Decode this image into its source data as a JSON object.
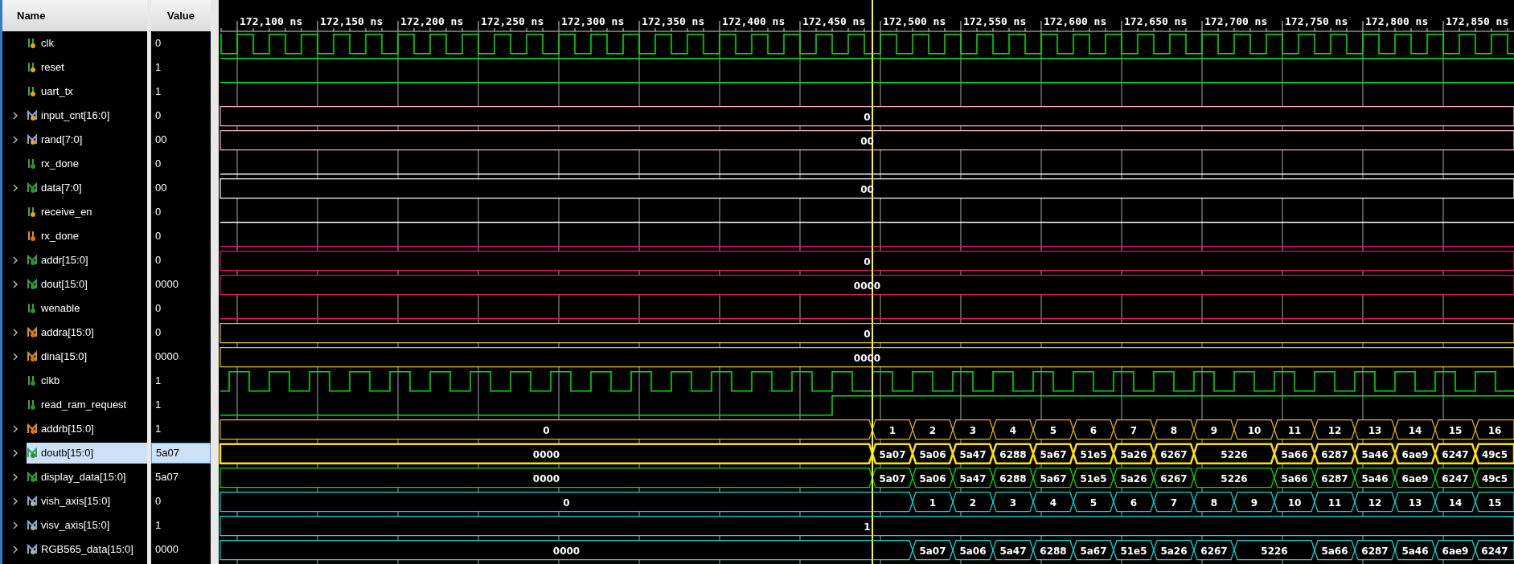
{
  "columns": {
    "name": "Name",
    "value": "Value"
  },
  "ruler": {
    "labels": [
      "172,100 ns",
      "172,150 ns",
      "172,200 ns",
      "172,250 ns",
      "172,300 ns",
      "172,350 ns",
      "172,400 ns",
      "172,450 ns",
      "172,500 ns",
      "172,550 ns",
      "172,600 ns",
      "172,650 ns",
      "172,700 ns",
      "172,750 ns",
      "172,800 ns",
      "172,850 ns"
    ]
  },
  "signals": [
    {
      "name": "clk",
      "value": "0",
      "kind": "clock",
      "color": "#00e600",
      "selected": false
    },
    {
      "name": "reset",
      "value": "1",
      "kind": "high",
      "color": "#00e600",
      "selected": false
    },
    {
      "name": "uart_tx",
      "value": "1",
      "kind": "high",
      "color": "#00e600",
      "selected": false
    },
    {
      "name": "input_cnt[16:0]",
      "value": "0",
      "kind": "bus",
      "color": "#f4b4c2",
      "selected": false,
      "expanded": false,
      "segments": [
        "0"
      ]
    },
    {
      "name": "rand[7:0]",
      "value": "00",
      "kind": "bus",
      "color": "#f4b4c2",
      "selected": false,
      "expanded": false,
      "segments": [
        "00"
      ]
    },
    {
      "name": "rx_done",
      "value": "0",
      "kind": "low",
      "color": "#ffffff",
      "selected": false
    },
    {
      "name": "data[7:0]",
      "value": "00",
      "kind": "bus",
      "color": "#ffffff",
      "selected": false,
      "expanded": false,
      "segments": [
        "00"
      ]
    },
    {
      "name": "receive_en",
      "value": "0",
      "kind": "low",
      "color": "#ffffff",
      "selected": false
    },
    {
      "name": "rx_done",
      "value": "0",
      "kind": "low",
      "color": "#e0186c",
      "selected": false
    },
    {
      "name": "addr[15:0]",
      "value": "0",
      "kind": "bus",
      "color": "#e0186c",
      "selected": false,
      "expanded": false,
      "segments": [
        "0"
      ]
    },
    {
      "name": "dout[15:0]",
      "value": "0000",
      "kind": "bus",
      "color": "#e0186c",
      "selected": false,
      "expanded": false,
      "segments": [
        "0000"
      ]
    },
    {
      "name": "wenable",
      "value": "0",
      "kind": "low",
      "color": "#e0186c",
      "selected": false
    },
    {
      "name": "addra[15:0]",
      "value": "0",
      "kind": "bus",
      "color": "#e6c619",
      "selected": false,
      "expanded": false,
      "segments": [
        "0"
      ]
    },
    {
      "name": "dina[15:0]",
      "value": "0000",
      "kind": "bus",
      "color": "#e6c619",
      "selected": false,
      "expanded": false,
      "segments": [
        "0000"
      ]
    },
    {
      "name": "clkb",
      "value": "1",
      "kind": "clock",
      "color": "#00e600",
      "selected": false
    },
    {
      "name": "read_ram_request",
      "value": "1",
      "kind": "step",
      "color": "#00e600",
      "selected": false
    },
    {
      "name": "addrb[15:0]",
      "value": "1",
      "kind": "bus",
      "color": "#e6b800",
      "selected": false,
      "expanded": false,
      "segments": [
        "0",
        "1",
        "2",
        "3",
        "4",
        "5",
        "6",
        "7",
        "8",
        "9",
        "10",
        "11",
        "12",
        "13",
        "14",
        "15",
        "16"
      ]
    },
    {
      "name": "doutb[15:0]",
      "value": "5a07",
      "kind": "bus",
      "color": "#ffe000",
      "selected": true,
      "expanded": false,
      "segments": [
        "0000",
        "5a07",
        "5a06",
        "5a47",
        "6288",
        "5a67",
        "51e5",
        "5a26",
        "6267",
        "5226",
        "5a66",
        "6287",
        "5a46",
        "6ae9",
        "6247",
        "49c5"
      ]
    },
    {
      "name": "display_data[15:0]",
      "value": "5a07",
      "kind": "bus",
      "color": "#00e600",
      "selected": false,
      "expanded": false,
      "segments": [
        "0000",
        "5a07",
        "5a06",
        "5a47",
        "6288",
        "5a67",
        "51e5",
        "5a26",
        "6267",
        "5226",
        "5a66",
        "6287",
        "5a46",
        "6ae9",
        "6247",
        "49c5"
      ]
    },
    {
      "name": "vish_axis[15:0]",
      "value": "0",
      "kind": "bus",
      "color": "#00e0e0",
      "selected": false,
      "expanded": false,
      "segments": [
        "0",
        "1",
        "2",
        "3",
        "4",
        "5",
        "6",
        "7",
        "8",
        "9",
        "10",
        "11",
        "12",
        "13",
        "14",
        "15"
      ]
    },
    {
      "name": "visv_axis[15:0]",
      "value": "1",
      "kind": "bus",
      "color": "#00e0e0",
      "selected": false,
      "expanded": false,
      "segments": [
        "1"
      ]
    },
    {
      "name": "RGB565_data[15:0]",
      "value": "0000",
      "kind": "bus",
      "color": "#00e0e0",
      "selected": false,
      "expanded": false,
      "segments": [
        "0000",
        "5a07",
        "5a06",
        "5a47",
        "6288",
        "5a67",
        "51e5",
        "5a26",
        "6267",
        "5226",
        "5a66",
        "6287",
        "5a46",
        "6ae9",
        "6247"
      ]
    }
  ]
}
